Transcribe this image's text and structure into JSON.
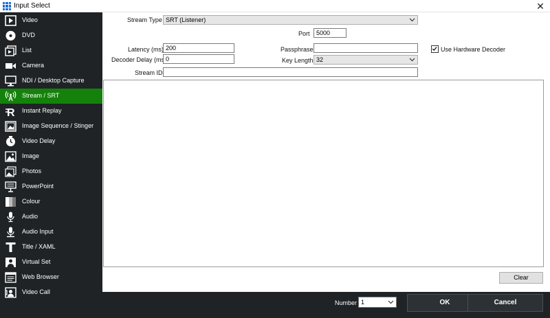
{
  "window": {
    "title": "Input Select",
    "close_glyph": "✕"
  },
  "sidebar": {
    "items": [
      {
        "label": "Video",
        "icon": "video-file-icon"
      },
      {
        "label": "DVD",
        "icon": "disc-icon"
      },
      {
        "label": "List",
        "icon": "list-icon"
      },
      {
        "label": "Camera",
        "icon": "camera-icon"
      },
      {
        "label": "NDI / Desktop Capture",
        "icon": "monitor-icon"
      },
      {
        "label": "Stream / SRT",
        "icon": "antenna-icon",
        "active": true
      },
      {
        "label": "Instant Replay",
        "icon": "replay-icon"
      },
      {
        "label": "Image Sequence / Stinger",
        "icon": "image-sequence-icon"
      },
      {
        "label": "Video Delay",
        "icon": "clock-icon"
      },
      {
        "label": "Image",
        "icon": "image-icon"
      },
      {
        "label": "Photos",
        "icon": "photos-icon"
      },
      {
        "label": "PowerPoint",
        "icon": "presentation-icon"
      },
      {
        "label": "Colour",
        "icon": "colour-icon"
      },
      {
        "label": "Audio",
        "icon": "microphone-icon"
      },
      {
        "label": "Audio Input",
        "icon": "audio-input-icon"
      },
      {
        "label": "Title / XAML",
        "icon": "title-icon"
      },
      {
        "label": "Virtual Set",
        "icon": "virtual-set-icon"
      },
      {
        "label": "Web Browser",
        "icon": "browser-icon"
      },
      {
        "label": "Video Call",
        "icon": "video-call-icon"
      }
    ],
    "active_color": "#14820a"
  },
  "form": {
    "stream_type_label": "Stream Type",
    "stream_type_value": "SRT (Listener)",
    "port_label": "Port",
    "port_value": "5000",
    "latency_label": "Latency (ms)",
    "latency_value": "200",
    "passphrase_label": "Passphrase",
    "passphrase_value": "",
    "hw_decoder_label": "Use Hardware Decoder",
    "hw_decoder_checked": true,
    "decoder_delay_label": "Decoder Delay (ms)",
    "decoder_delay_value": "0",
    "key_length_label": "Key Length",
    "key_length_value": "32",
    "stream_id_label": "Stream ID",
    "stream_id_value": "",
    "clear_label": "Clear"
  },
  "footer": {
    "number_label": "Number",
    "number_value": "1",
    "ok_label": "OK",
    "cancel_label": "Cancel"
  }
}
